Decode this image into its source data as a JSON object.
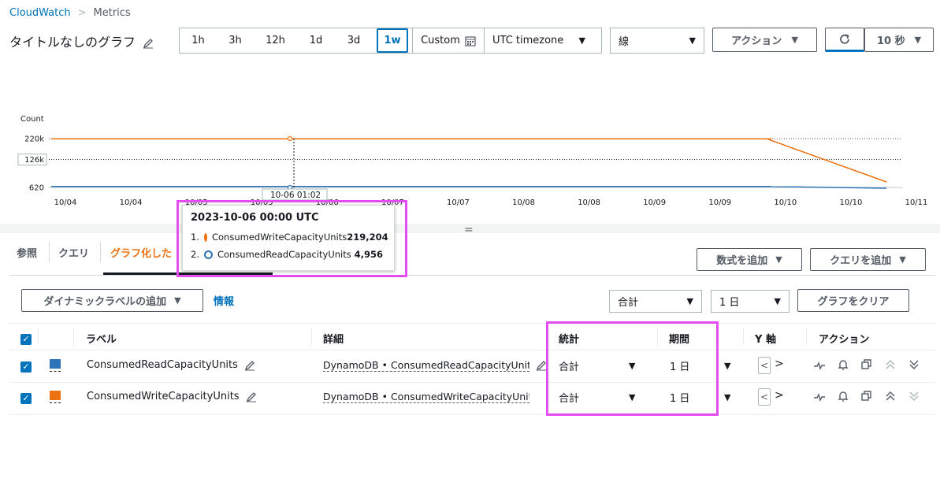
{
  "breadcrumb": {
    "root": "CloudWatch",
    "current": "Metrics"
  },
  "graph_title": "タイトルなしのグラフ",
  "time_range": {
    "options": [
      "1h",
      "3h",
      "12h",
      "1d",
      "3d",
      "1w"
    ],
    "active": "1w",
    "custom": "Custom"
  },
  "timezone": "UTC timezone",
  "chart_type": "線",
  "actions_label": "アクション",
  "refresh_interval": "10 秒",
  "chart_data": {
    "type": "line",
    "ylabel": "Count",
    "y_ticks": [
      "220k",
      "126k",
      "620"
    ],
    "ylim": [
      620,
      220000
    ],
    "x_ticks": [
      "10/04",
      "10/04",
      "10/05",
      "10/05",
      "10/06",
      "10/07",
      "10/07",
      "10/08",
      "10/08",
      "10/09",
      "10/09",
      "10/10",
      "10/10",
      "10/11"
    ],
    "cursor_label": "10-06 01:02",
    "series": [
      {
        "name": "ConsumedWriteCapacityUnits",
        "color": "#ec7211",
        "values": [
          219204,
          219204,
          219204,
          219204,
          219204,
          219204,
          219204,
          219204,
          219204,
          219204,
          219204,
          219204,
          110000,
          20000
        ]
      },
      {
        "name": "ConsumedReadCapacityUnits",
        "color": "#2e73b8",
        "values": [
          4956,
          4956,
          4956,
          4956,
          4956,
          4956,
          4956,
          4956,
          4956,
          4956,
          4956,
          4956,
          1500,
          620
        ]
      }
    ]
  },
  "tooltip": {
    "time": "2023-10-06 00:00 UTC",
    "rows": [
      {
        "index": "1.",
        "label": "ConsumedWriteCapacityUnits",
        "value": "219,204",
        "color": "#ec7211"
      },
      {
        "index": "2.",
        "label": "ConsumedReadCapacityUnits",
        "value": "4,956",
        "color": "#2e73b8"
      }
    ]
  },
  "tabs": [
    "参照",
    "クエリ",
    "グラフ化した"
  ],
  "add_math": "数式を追加",
  "add_query": "クエリを追加",
  "dynamic_label": "ダイナミックラベルの追加",
  "info_link": "情報",
  "stat_select": "合計",
  "period_select": "1 日",
  "clear_graph": "グラフをクリア",
  "table": {
    "headers": {
      "label": "ラベル",
      "details": "詳細",
      "stat": "統計",
      "period": "期間",
      "yaxis": "Y 軸",
      "actions": "アクション"
    },
    "rows": [
      {
        "label": "ConsumedReadCapacityUnits",
        "details": "DynamoDB • ConsumedReadCapacityUnits",
        "stat": "合計",
        "period": "1 日",
        "color": "#2e73b8"
      },
      {
        "label": "ConsumedWriteCapacityUnits",
        "details": "DynamoDB • ConsumedWriteCapacityUnits",
        "stat": "合計",
        "period": "1 日",
        "color": "#ec7211"
      }
    ]
  }
}
